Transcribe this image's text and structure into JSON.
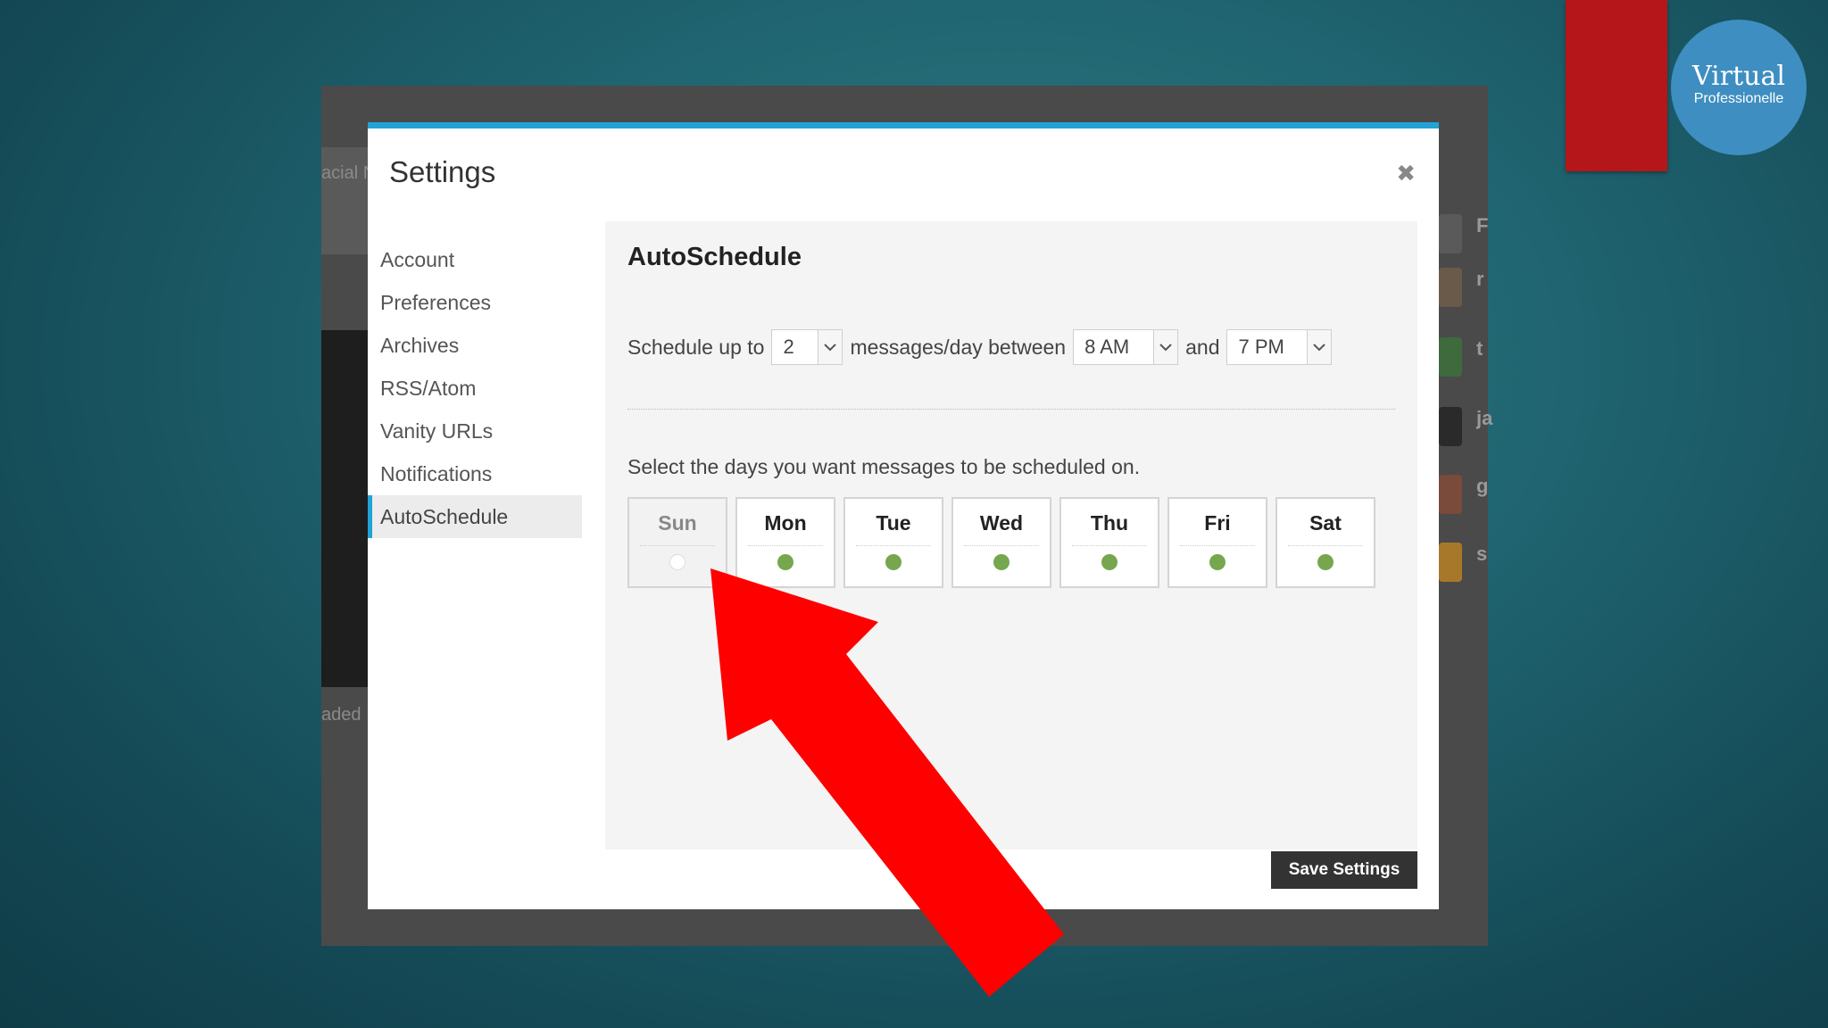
{
  "brand": {
    "title": "Virtual",
    "subtitle": "Professionelle"
  },
  "background_app": {
    "texts": [
      "acial N",
      "aded"
    ],
    "right_letters": [
      "F",
      "r",
      "t",
      "ja",
      "g",
      "s"
    ]
  },
  "modal": {
    "title": "Settings",
    "close_icon": "close-icon",
    "nav": [
      {
        "label": "Account"
      },
      {
        "label": "Preferences"
      },
      {
        "label": "Archives"
      },
      {
        "label": "RSS/Atom"
      },
      {
        "label": "Vanity URLs"
      },
      {
        "label": "Notifications"
      },
      {
        "label": "AutoSchedule",
        "active": true
      }
    ],
    "autoschedule": {
      "title": "AutoSchedule",
      "prefix": "Schedule up to",
      "count": "2",
      "middle": "messages/day between",
      "start_time": "8 AM",
      "joiner": "and",
      "end_time": "7 PM",
      "days_label": "Select the days you want messages to be scheduled on.",
      "days": [
        {
          "name": "Sun",
          "enabled": false
        },
        {
          "name": "Mon",
          "enabled": true
        },
        {
          "name": "Tue",
          "enabled": true
        },
        {
          "name": "Wed",
          "enabled": true
        },
        {
          "name": "Thu",
          "enabled": true
        },
        {
          "name": "Fri",
          "enabled": true
        },
        {
          "name": "Sat",
          "enabled": true
        }
      ]
    },
    "save_label": "Save Settings"
  },
  "colors": {
    "accent": "#22a3d6",
    "enabled_dot": "#76a64e",
    "annotation_arrow": "#ff0000",
    "brand_red": "#b5161a",
    "brand_blue": "#3e8ec1"
  }
}
